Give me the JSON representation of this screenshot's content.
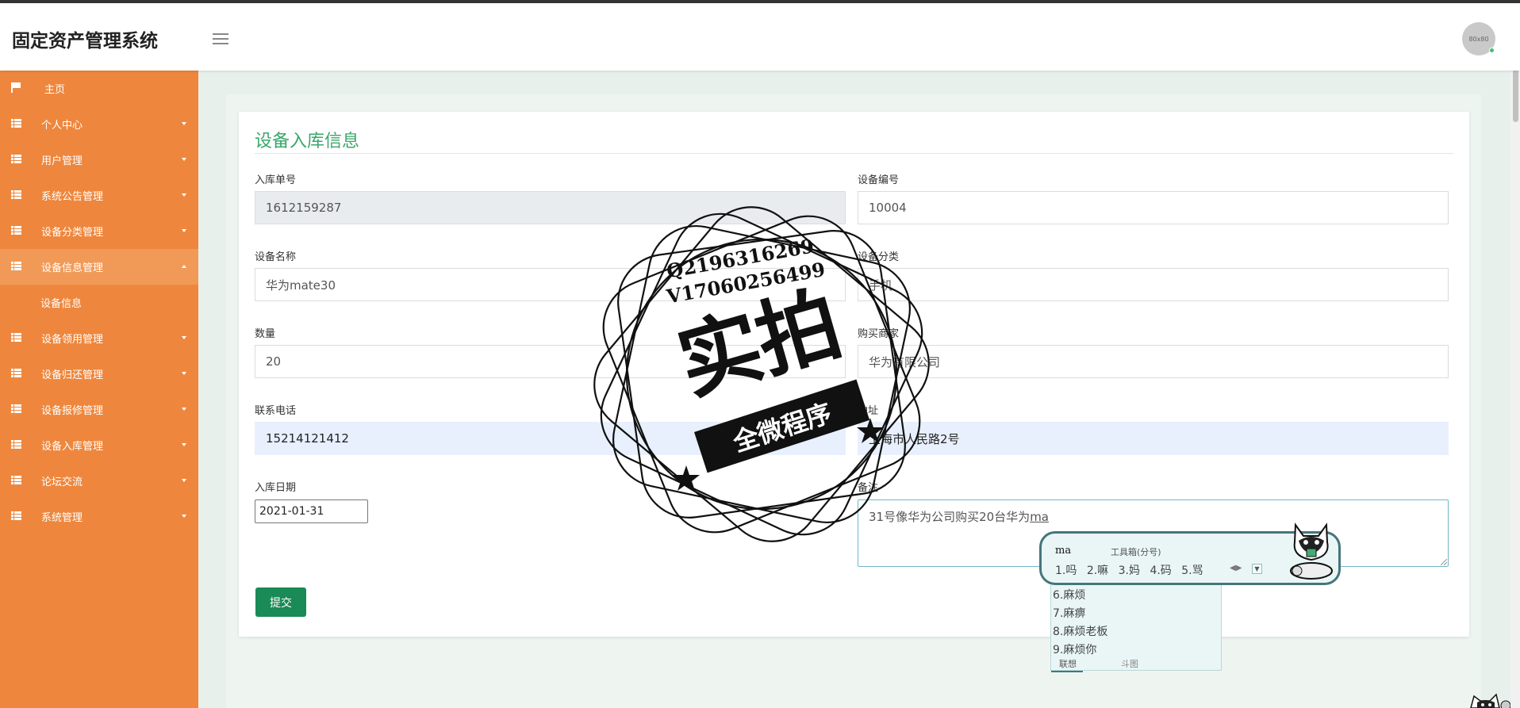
{
  "header": {
    "title": "固定资产管理系统",
    "avatar_text": "80x80"
  },
  "sidebar": {
    "items": [
      {
        "label": "主页",
        "icon": "flag-icon"
      },
      {
        "label": "个人中心",
        "icon": "grid-icon"
      },
      {
        "label": "用户管理",
        "icon": "grid-icon"
      },
      {
        "label": "系统公告管理",
        "icon": "grid-icon"
      },
      {
        "label": "设备分类管理",
        "icon": "grid-icon"
      },
      {
        "label": "设备信息管理",
        "icon": "grid-icon",
        "expanded": true
      },
      {
        "label": "设备领用管理",
        "icon": "grid-icon"
      },
      {
        "label": "设备归还管理",
        "icon": "grid-icon"
      },
      {
        "label": "设备报修管理",
        "icon": "grid-icon"
      },
      {
        "label": "设备入库管理",
        "icon": "grid-icon"
      },
      {
        "label": "论坛交流",
        "icon": "grid-icon"
      },
      {
        "label": "系统管理",
        "icon": "grid-icon"
      }
    ],
    "subitem": "设备信息"
  },
  "form": {
    "title": "设备入库信息",
    "fields": {
      "order_no": {
        "label": "入库单号",
        "value": "1612159287"
      },
      "device_no": {
        "label": "设备编号",
        "value": "10004"
      },
      "device_name": {
        "label": "设备名称",
        "value": "华为mate30"
      },
      "device_category": {
        "label": "设备分类",
        "value": "手机"
      },
      "quantity": {
        "label": "数量",
        "value": "20"
      },
      "vendor": {
        "label": "购买商家",
        "value": "华为有限公司"
      },
      "phone": {
        "label": "联系电话",
        "value": "15214121412"
      },
      "address": {
        "label": "地址",
        "value": "上海市人民路2号"
      },
      "date": {
        "label": "入库日期",
        "value": "2021-01-31"
      },
      "remark": {
        "label": "备注",
        "value_prefix": "31号像华为公司购买20台华为",
        "value_composing": "ma"
      }
    },
    "submit_label": "提交"
  },
  "watermark": {
    "qq": "Q2196316269",
    "wechat": "V17060256499",
    "big": "实拍",
    "ribbon": "全微程序"
  },
  "ime": {
    "composition": "ma",
    "toolbox": "工具箱(分号)",
    "candidates_row": [
      "1.吗",
      "2.嘛",
      "3.妈",
      "4.码",
      "5.骂"
    ],
    "candidates_list": [
      "6.麻烦",
      "7.麻痹",
      "8.麻烦老板",
      "9.麻烦你"
    ],
    "tab_active": "联想",
    "tab_other": "斗图"
  },
  "colors": {
    "sidebar_bg": "#ee873d",
    "accent_green": "#3aa76a",
    "submit_bg": "#1a8a56"
  }
}
